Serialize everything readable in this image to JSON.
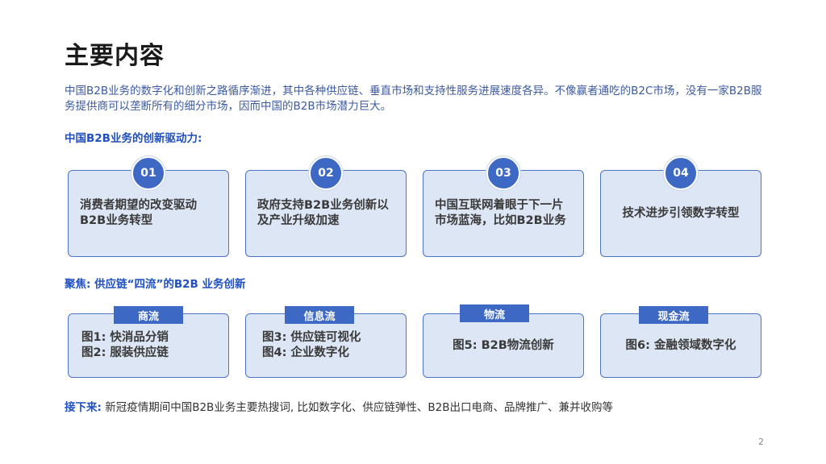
{
  "title": "主要内容",
  "intro": "中国B2B业务的数字化和创新之路循序渐进，其中各种供应链、垂直市场和支持性服务进展速度各异。不像赢者通吃的B2C市场，没有一家B2B服务提供商可以垄断所有的细分市场，因而中国的B2B市场潜力巨大。",
  "drivers_heading": "中国B2B业务的创新驱动力:",
  "drivers": [
    {
      "num": "01",
      "text": "消费者期望的改变驱动B2B业务转型"
    },
    {
      "num": "02",
      "text": "政府支持B2B业务创新以及产业升级加速"
    },
    {
      "num": "03",
      "text": "中国互联网着眼于下一片市场蓝海，比如B2B业务"
    },
    {
      "num": "04",
      "text": "技术进步引领数字转型"
    }
  ],
  "flows_heading": "聚焦: 供应链“四流”的B2B 业务创新",
  "flows": [
    {
      "tab": "商流",
      "lines": [
        "图1: 快消品分销",
        "图2: 服装供应链"
      ]
    },
    {
      "tab": "信息流",
      "lines": [
        "图3: 供应链可视化",
        "图4: 企业数字化"
      ]
    },
    {
      "tab": "物流",
      "lines": [
        "图5: B2B物流创新"
      ]
    },
    {
      "tab": "现金流",
      "lines": [
        "图6: 金融领域数字化"
      ]
    }
  ],
  "next": {
    "label": "接下来:",
    "text": "新冠疫情期间中国B2B业务主要热搜词, 比如数字化、供应链弹性、B2B出口电商、品牌推广、兼并收购等"
  },
  "page_number": "2",
  "colors": {
    "accent": "#3d68c4",
    "card_bg": "#dce6f4",
    "heading": "#1f4fc0"
  }
}
